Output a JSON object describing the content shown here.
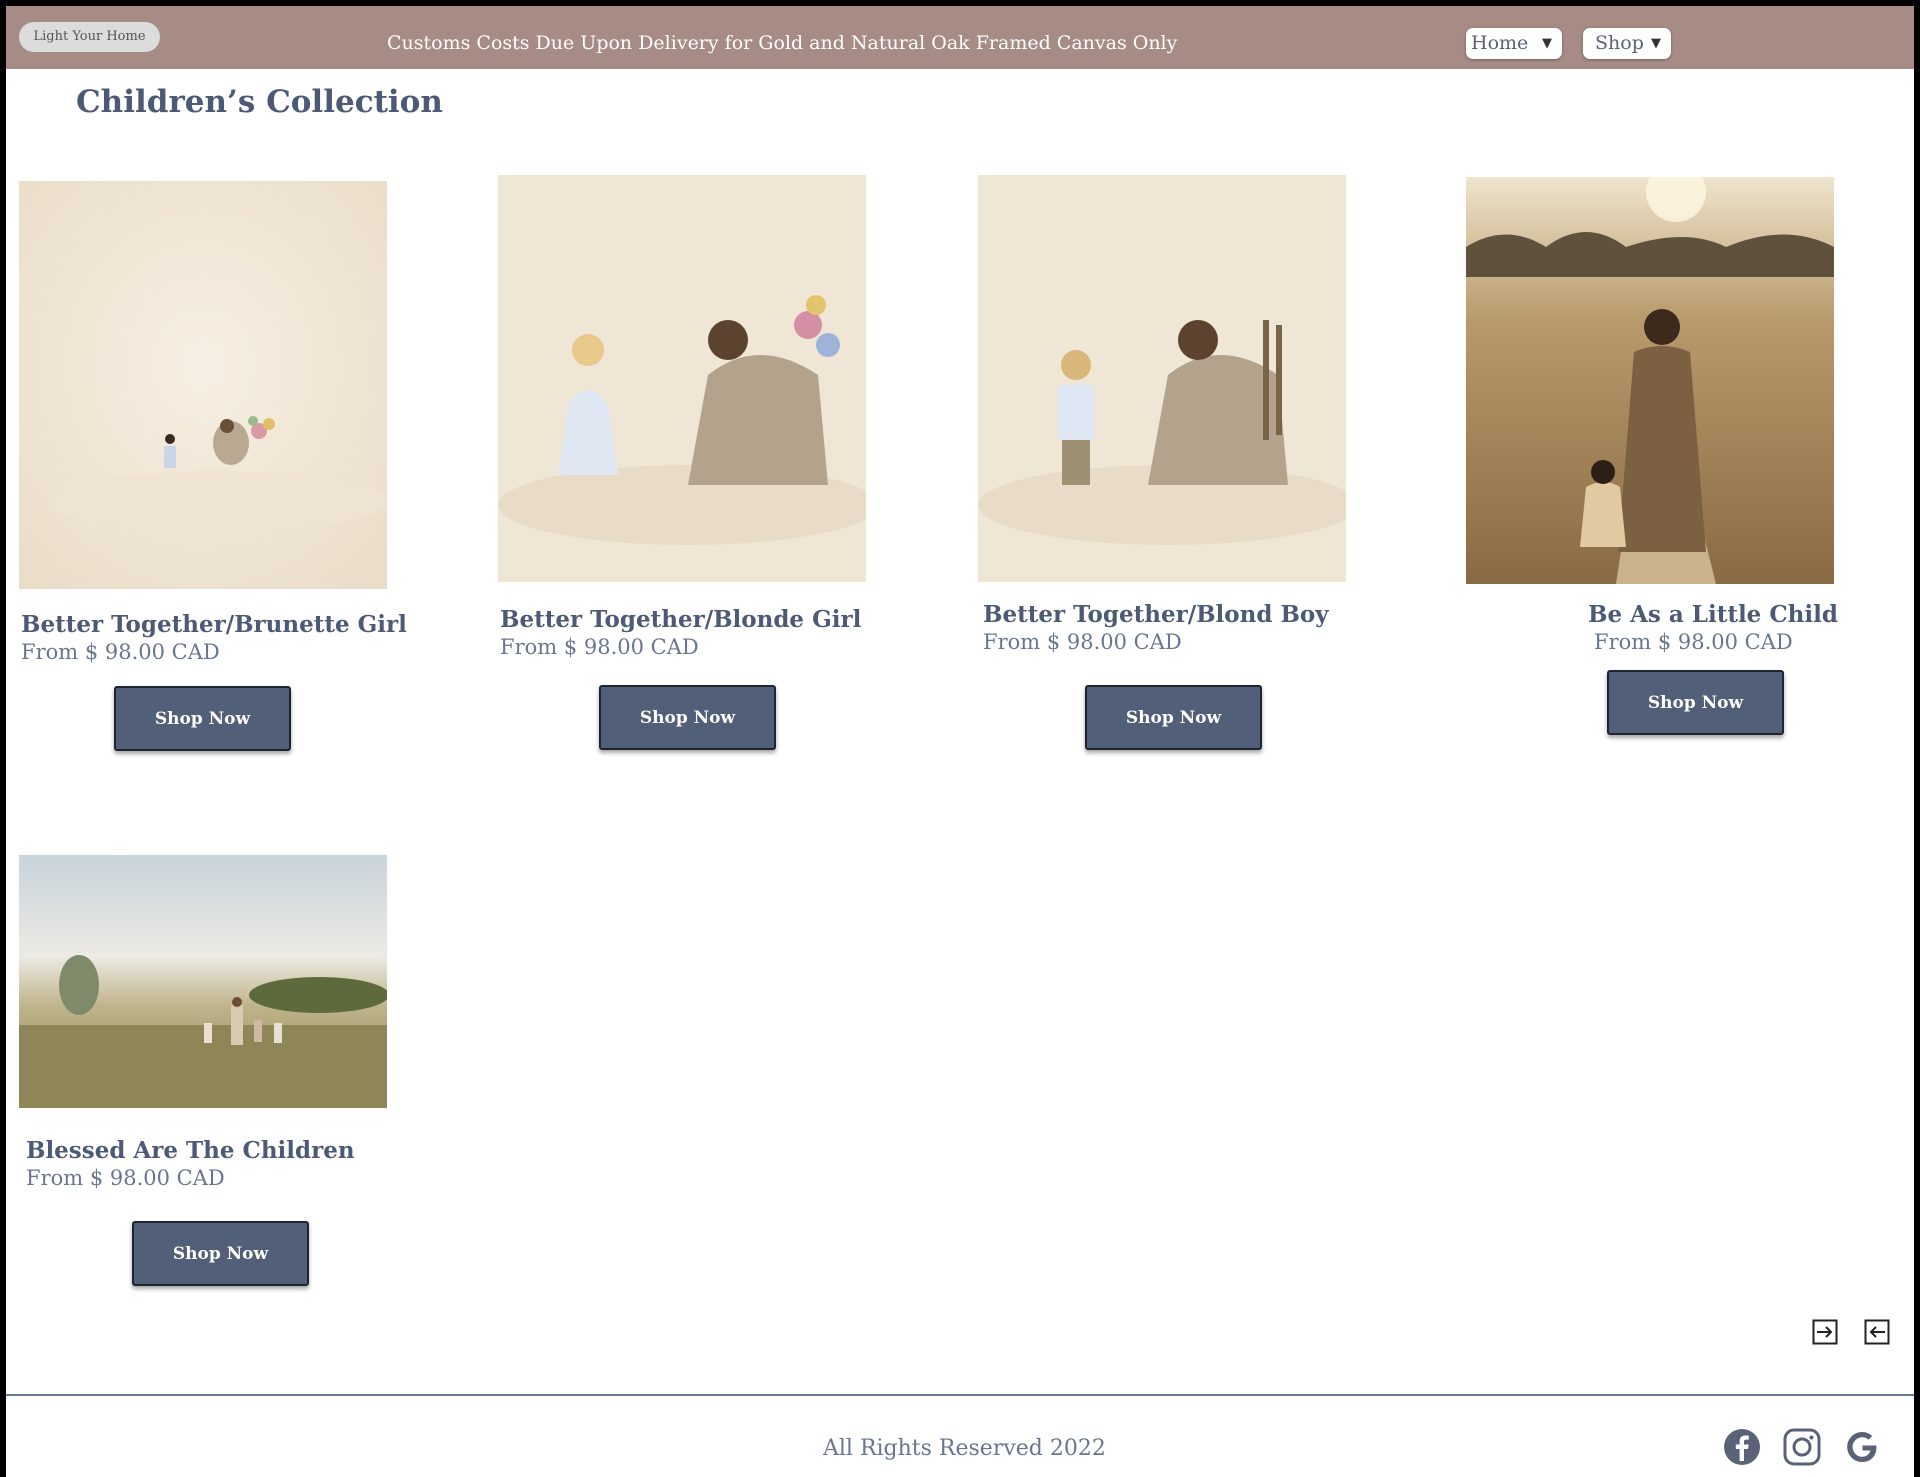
{
  "header": {
    "logo_label": "Light Your Home",
    "announcement": "Customs Costs Due Upon Delivery for Gold and Natural Oak Framed Canvas Only",
    "nav": [
      {
        "label": "Home"
      },
      {
        "label": "Shop"
      }
    ],
    "caret": "▼"
  },
  "page_title": "Children’s Collection",
  "products": [
    {
      "title": "Better Together/Brunette Girl",
      "price": "From $ 98.00 CAD",
      "button": "Shop Now",
      "image": "jesus-with-brunette-girl-painting"
    },
    {
      "title": "Better Together/Blonde Girl",
      "price": "From $ 98.00 CAD",
      "button": "Shop Now",
      "image": "jesus-with-blonde-girl-painting"
    },
    {
      "title": "Better Together/Blond Boy",
      "price": "From $ 98.00 CAD",
      "button": "Shop Now",
      "image": "jesus-with-blond-boy-painting"
    },
    {
      "title": "Be As a Little Child",
      "price": "From $ 98.00 CAD",
      "button": "Shop Now",
      "image": "jesus-walking-child-field-painting"
    },
    {
      "title": "Blessed Are The Children",
      "price": "From $ 98.00 CAD",
      "button": "Shop Now",
      "image": "jesus-children-meadow-painting"
    }
  ],
  "pager": {
    "icons": [
      "next-page-icon",
      "previous-page-icon"
    ]
  },
  "footer": {
    "copyright": "All Rights Reserved 2022",
    "social_icons": [
      "facebook-icon",
      "instagram-icon",
      "google-icon"
    ]
  },
  "colors": {
    "topbar": "#a68c84",
    "button": "#525f78",
    "text": "#4d5a76"
  }
}
